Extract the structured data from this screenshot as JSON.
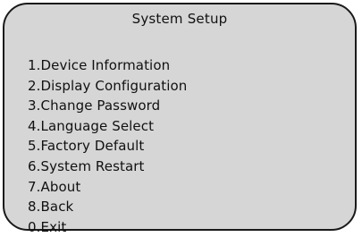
{
  "screen": {
    "title": "System Setup",
    "menu_items": [
      {
        "label": "1.Device Information"
      },
      {
        "label": "2.Display Configuration"
      },
      {
        "label": "3.Change Password"
      },
      {
        "label": "4.Language Select"
      },
      {
        "label": "5.Factory Default"
      },
      {
        "label": "6.System Restart"
      },
      {
        "label": "7.About"
      },
      {
        "label": "8.Back"
      },
      {
        "label": "0.Exit"
      }
    ]
  },
  "colors": {
    "panel_background": "#d6d6d6",
    "panel_border": "#1a1a1a",
    "text": "#111111"
  }
}
